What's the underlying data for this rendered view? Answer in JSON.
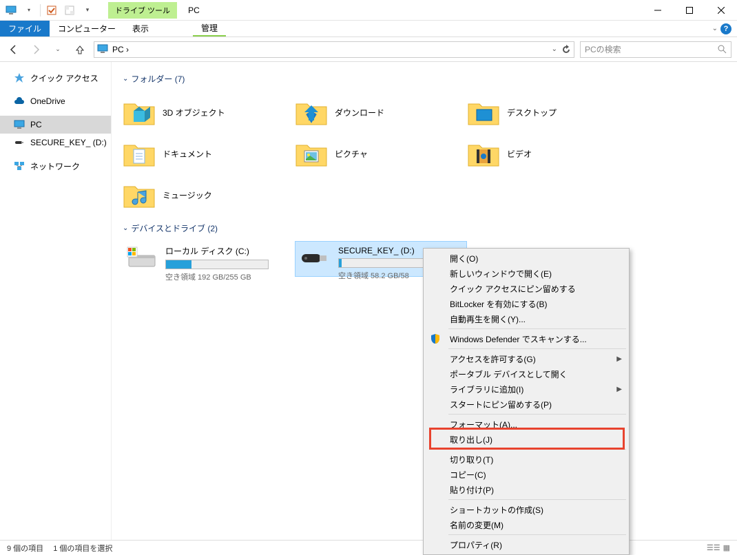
{
  "titlebar": {
    "drive_tools": "ドライブ ツール",
    "app_title": "PC"
  },
  "ribbon": {
    "file": "ファイル",
    "computer": "コンピューター",
    "view": "表示",
    "manage": "管理"
  },
  "navbar": {
    "breadcrumb": "PC ›",
    "search_placeholder": "PCの検索"
  },
  "sidebar": {
    "items": [
      {
        "label": "クイック アクセス",
        "icon": "star"
      },
      {
        "label": "OneDrive",
        "icon": "cloud"
      },
      {
        "label": "PC",
        "icon": "monitor",
        "selected": true
      },
      {
        "label": "SECURE_KEY_ (D:)",
        "icon": "usb"
      },
      {
        "label": "ネットワーク",
        "icon": "network"
      }
    ]
  },
  "groups": {
    "folders_header": "フォルダー (7)",
    "drives_header": "デバイスとドライブ (2)"
  },
  "folders": [
    {
      "label": "3D オブジェクト",
      "type": "3d"
    },
    {
      "label": "ダウンロード",
      "type": "download"
    },
    {
      "label": "デスクトップ",
      "type": "desktop"
    },
    {
      "label": "ドキュメント",
      "type": "document"
    },
    {
      "label": "ピクチャ",
      "type": "picture"
    },
    {
      "label": "ビデオ",
      "type": "video"
    },
    {
      "label": "ミュージック",
      "type": "music"
    }
  ],
  "drives": [
    {
      "name": "ローカル ディスク (C:)",
      "free": "空き領域 192 GB/255 GB",
      "fill_pct": 25,
      "selected": false,
      "kind": "hdd"
    },
    {
      "name": "SECURE_KEY_ (D:)",
      "free": "空き領域 58.2 GB/58",
      "fill_pct": 3,
      "selected": true,
      "kind": "usb"
    }
  ],
  "context_menu": [
    {
      "label": "開く(O)"
    },
    {
      "label": "新しいウィンドウで開く(E)"
    },
    {
      "label": "クイック アクセスにピン留めする"
    },
    {
      "label": "BitLocker を有効にする(B)"
    },
    {
      "label": "自動再生を開く(Y)..."
    },
    {
      "sep": true
    },
    {
      "label": "Windows Defender でスキャンする...",
      "icon": "shield"
    },
    {
      "sep": true
    },
    {
      "label": "アクセスを許可する(G)",
      "submenu": true
    },
    {
      "label": "ポータブル デバイスとして開く"
    },
    {
      "label": "ライブラリに追加(I)",
      "submenu": true
    },
    {
      "label": "スタートにピン留めする(P)"
    },
    {
      "sep": true
    },
    {
      "label": "フォーマット(A)..."
    },
    {
      "label": "取り出し(J)",
      "highlighted": true
    },
    {
      "sep": true
    },
    {
      "label": "切り取り(T)"
    },
    {
      "label": "コピー(C)"
    },
    {
      "label": "貼り付け(P)"
    },
    {
      "sep": true
    },
    {
      "label": "ショートカットの作成(S)"
    },
    {
      "label": "名前の変更(M)"
    },
    {
      "sep": true
    },
    {
      "label": "プロパティ(R)"
    }
  ],
  "statusbar": {
    "items_count": "9 個の項目",
    "selected": "1 個の項目を選択"
  }
}
